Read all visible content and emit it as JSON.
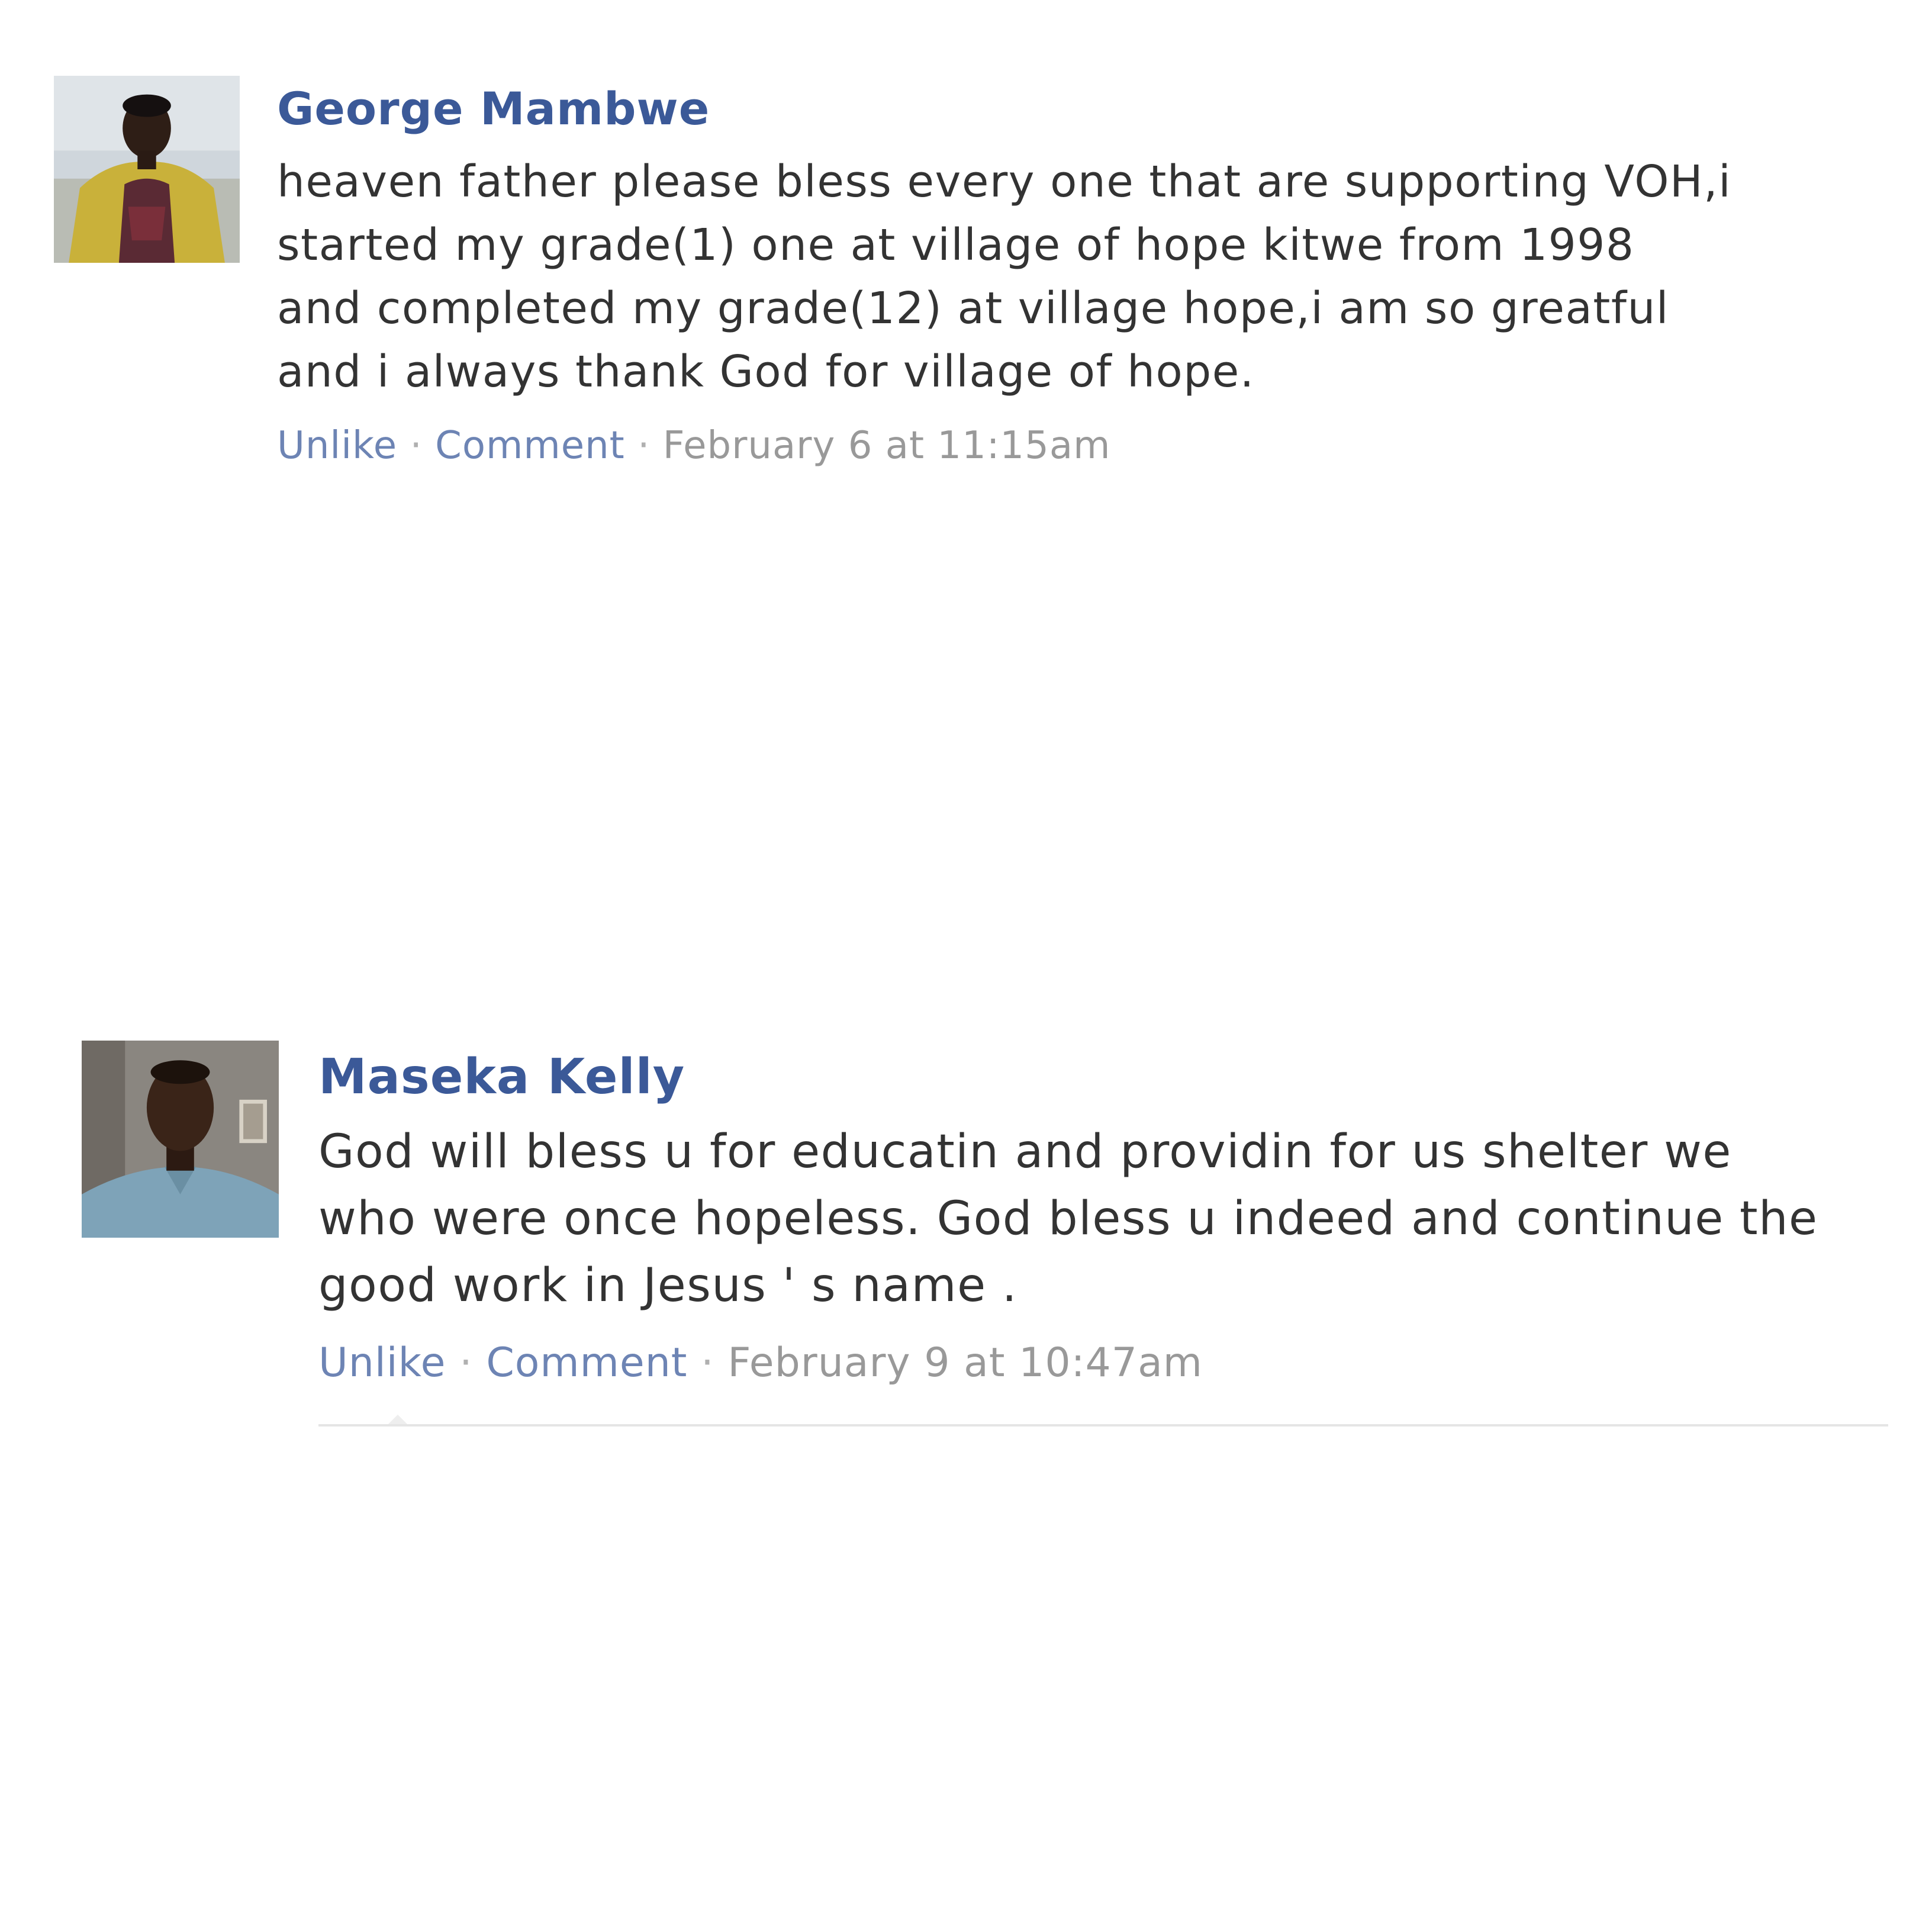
{
  "comments": [
    {
      "author": "George Mambwe",
      "lines": [
        "heaven father please bless every one that are supporting VOH,i",
        "started my grade(1) one at village of hope kitwe from 1998",
        "and completed my grade(12) at village hope,i am so greatful",
        "and i always thank God for village of hope."
      ],
      "unlike_label": "Unlike",
      "comment_label": "Comment",
      "separator": "·",
      "timestamp": "February 6 at 11:15am"
    },
    {
      "author": "Maseka Kelly",
      "lines": [
        "God will bless u for educatin and providin for us shelter we",
        "who were once hopeless. God bless u indeed and continue the",
        "good work in Jesus ' s name ."
      ],
      "unlike_label": "Unlike",
      "comment_label": "Comment",
      "separator": "·",
      "timestamp": "February 9 at 10:47am"
    }
  ],
  "colors": {
    "author_name": "#3b5998",
    "action_link": "#6d84b4",
    "timestamp": "#999999",
    "body_text": "#333333"
  }
}
